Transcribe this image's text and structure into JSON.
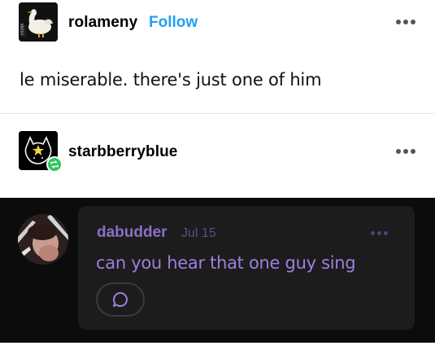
{
  "post": {
    "author": "rolameny",
    "follow_label": "Follow",
    "body": "le miserable. there's just one of him"
  },
  "reblog": {
    "author": "starbberryblue"
  },
  "comment": {
    "user": "dabudder",
    "date": "Jul 15",
    "text": "can you hear that one guy sing"
  },
  "icons": {
    "more": "more-horizontal-icon",
    "reblog": "reblog-icon",
    "reply": "speech-bubble-icon"
  },
  "colors": {
    "follow": "#1da1f2",
    "reblog_badge": "#2fc45c",
    "comment_accent": "#9d7fe0",
    "dark_panel": "#0c0c0c",
    "comment_card": "#1c1c1c"
  }
}
